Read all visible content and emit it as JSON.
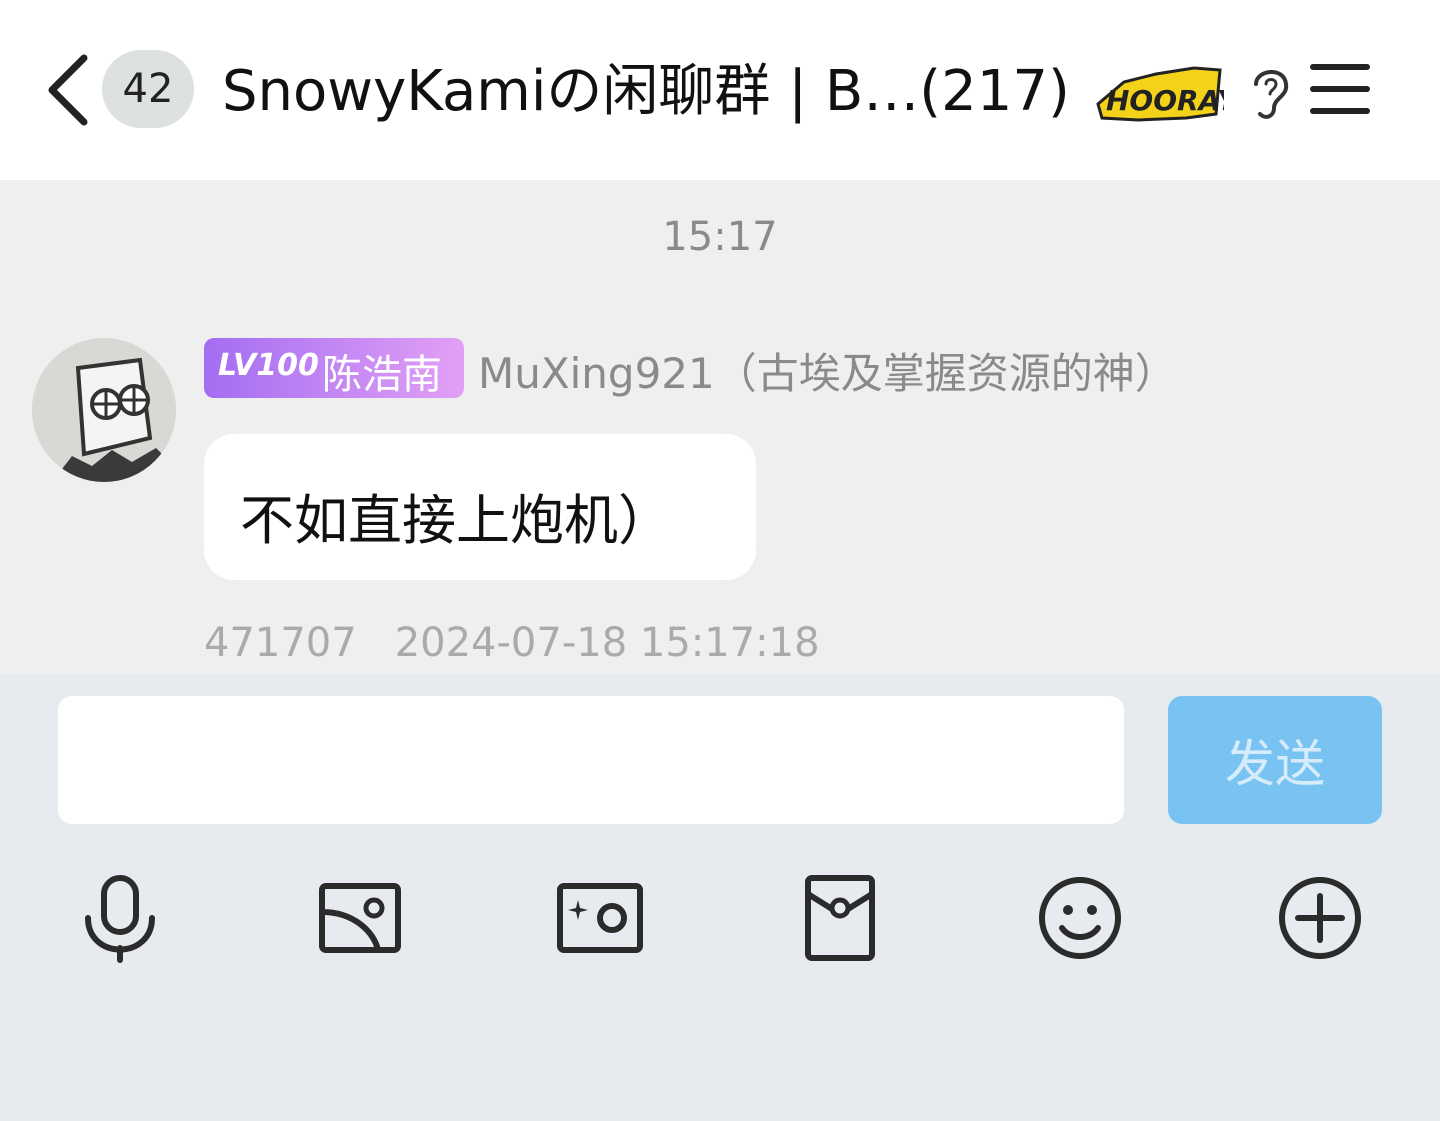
{
  "header": {
    "unread_count": "42",
    "title": "SnowyKamiの闲聊群 | B…(217)",
    "hooray_sticker": "HOORAY"
  },
  "chat": {
    "time_separator": "15:17",
    "message": {
      "level_label": "LV100",
      "tag_name": "陈浩南",
      "nickname": "MuXing921（古埃及掌握资源的神）",
      "text": "不如直接上炮机）",
      "user_id": "471707",
      "timestamp": "2024-07-18 15:17:18"
    }
  },
  "composer": {
    "input_value": "",
    "send_label": "发送"
  },
  "toolbar": {
    "icons": [
      "microphone-icon",
      "image-icon",
      "camera-icon",
      "red-packet-icon",
      "emoji-icon",
      "plus-icon"
    ]
  },
  "colors": {
    "accent": "#79c3f2",
    "level_tag_start": "#a46df2",
    "level_tag_end": "#e2a0f4"
  }
}
